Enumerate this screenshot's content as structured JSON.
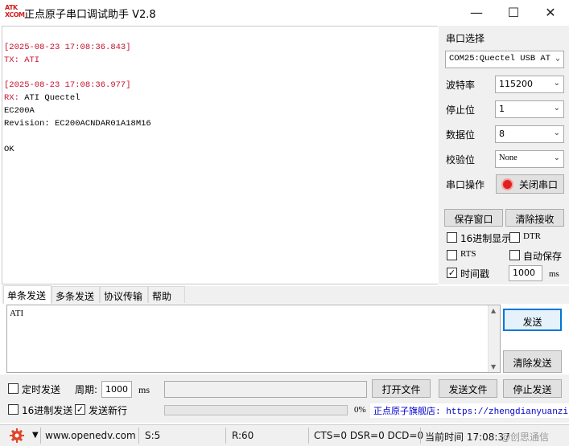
{
  "window": {
    "logo_line1": "ATK",
    "logo_line2": "XCOM",
    "title": "正点原子串口调试助手 V2.8",
    "minimize": "—",
    "maximize": "☐",
    "close": "✕"
  },
  "receive": {
    "lines": [
      {
        "text": "[2025-08-23 17:08:36.843]",
        "color": "#c8102e"
      },
      {
        "text": "TX: ATI",
        "color": "#c8102e"
      },
      {
        "text": "",
        "color": "#000000"
      },
      {
        "text": "[2025-08-23 17:08:36.977]",
        "color": "#c8102e"
      },
      {
        "rx_label": "RX:",
        "text": " ATI Quectel",
        "color": "#000000"
      },
      {
        "text": "EC200A",
        "color": "#000000"
      },
      {
        "text": "Revision: EC200ACNDAR01A18M16",
        "color": "#000000"
      },
      {
        "text": "",
        "color": "#000000"
      },
      {
        "text": "OK",
        "color": "#000000"
      }
    ]
  },
  "panel": {
    "port_select_label": "串口选择",
    "port_value": "COM25:Quectel USB AT",
    "baud_label": "波特率",
    "baud_value": "115200",
    "stopbit_label": "停止位",
    "stopbit_value": "1",
    "databit_label": "数据位",
    "databit_value": "8",
    "parity_label": "校验位",
    "parity_value": "None",
    "port_op_label": "串口操作",
    "close_port_button": "关闭串口",
    "save_window_button": "保存窗口",
    "clear_recv_button": "清除接收",
    "hex_display_label": "16进制显示",
    "dtr_label": "DTR",
    "rts_label": "RTS",
    "auto_save_label": "自动保存",
    "timestamp_label": "时间戳",
    "timestamp_value": "1000",
    "timestamp_unit": "ms"
  },
  "tabs": [
    "单条发送",
    "多条发送",
    "协议传输",
    "帮助"
  ],
  "send": {
    "text": "ATI",
    "send_button": "发送",
    "clear_send_button": "清除发送",
    "timed_send_label": "定时发送",
    "period_label": "周期:",
    "period_value": "1000",
    "period_unit": "ms",
    "open_file_button": "打开文件",
    "send_file_button": "发送文件",
    "stop_send_button": "停止发送",
    "hex_send_label": "16进制发送",
    "send_newline_label": "发送新行",
    "progress_percent": "0%",
    "progress_value": 0,
    "flagship_link": "正点原子旗舰店: https://zhengdianyuanzi"
  },
  "status": {
    "website": "www.openedv.com",
    "sent": "S:5",
    "received": "R:60",
    "signals": "CTS=0 DSR=0 DCD=0",
    "time": "当前时间 17:08:37",
    "watermark": "@创思通信"
  }
}
